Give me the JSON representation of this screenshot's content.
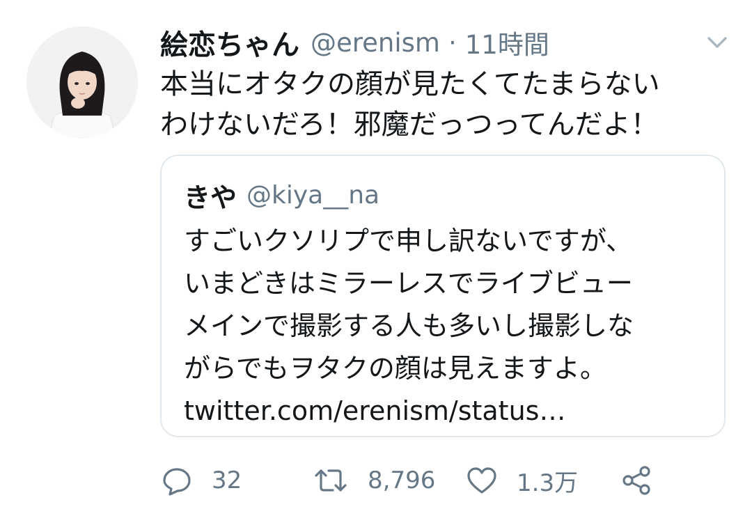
{
  "tweet": {
    "display_name": "絵恋ちゃん",
    "handle": "@erenism",
    "separator": "·",
    "time": "11時間",
    "text_lines": [
      "本当にオタクの顔が見たくてたまらない",
      "わけないだろ！邪魔だっつってんだよ！"
    ]
  },
  "quote": {
    "display_name": "きや",
    "handle": "@kiya__na",
    "text_lines": [
      "すごいクソリプで申し訳ないですが、",
      "いまどきはミラーレスでライブビュー",
      "メインで撮影する人も多いし撮影しな",
      "がらでもヲタクの顔は見えますよ。",
      "twitter.com/erenism/status…"
    ]
  },
  "actions": {
    "reply_count": "32",
    "retweet_count": "8,796",
    "like_count": "1.3万"
  },
  "icons": {
    "menu": "chevron-down-icon",
    "reply": "reply-icon",
    "retweet": "retweet-icon",
    "like": "heart-icon",
    "share": "share-icon"
  },
  "colors": {
    "text": "#14171a",
    "secondary": "#657786",
    "border": "#e1e8ed"
  }
}
